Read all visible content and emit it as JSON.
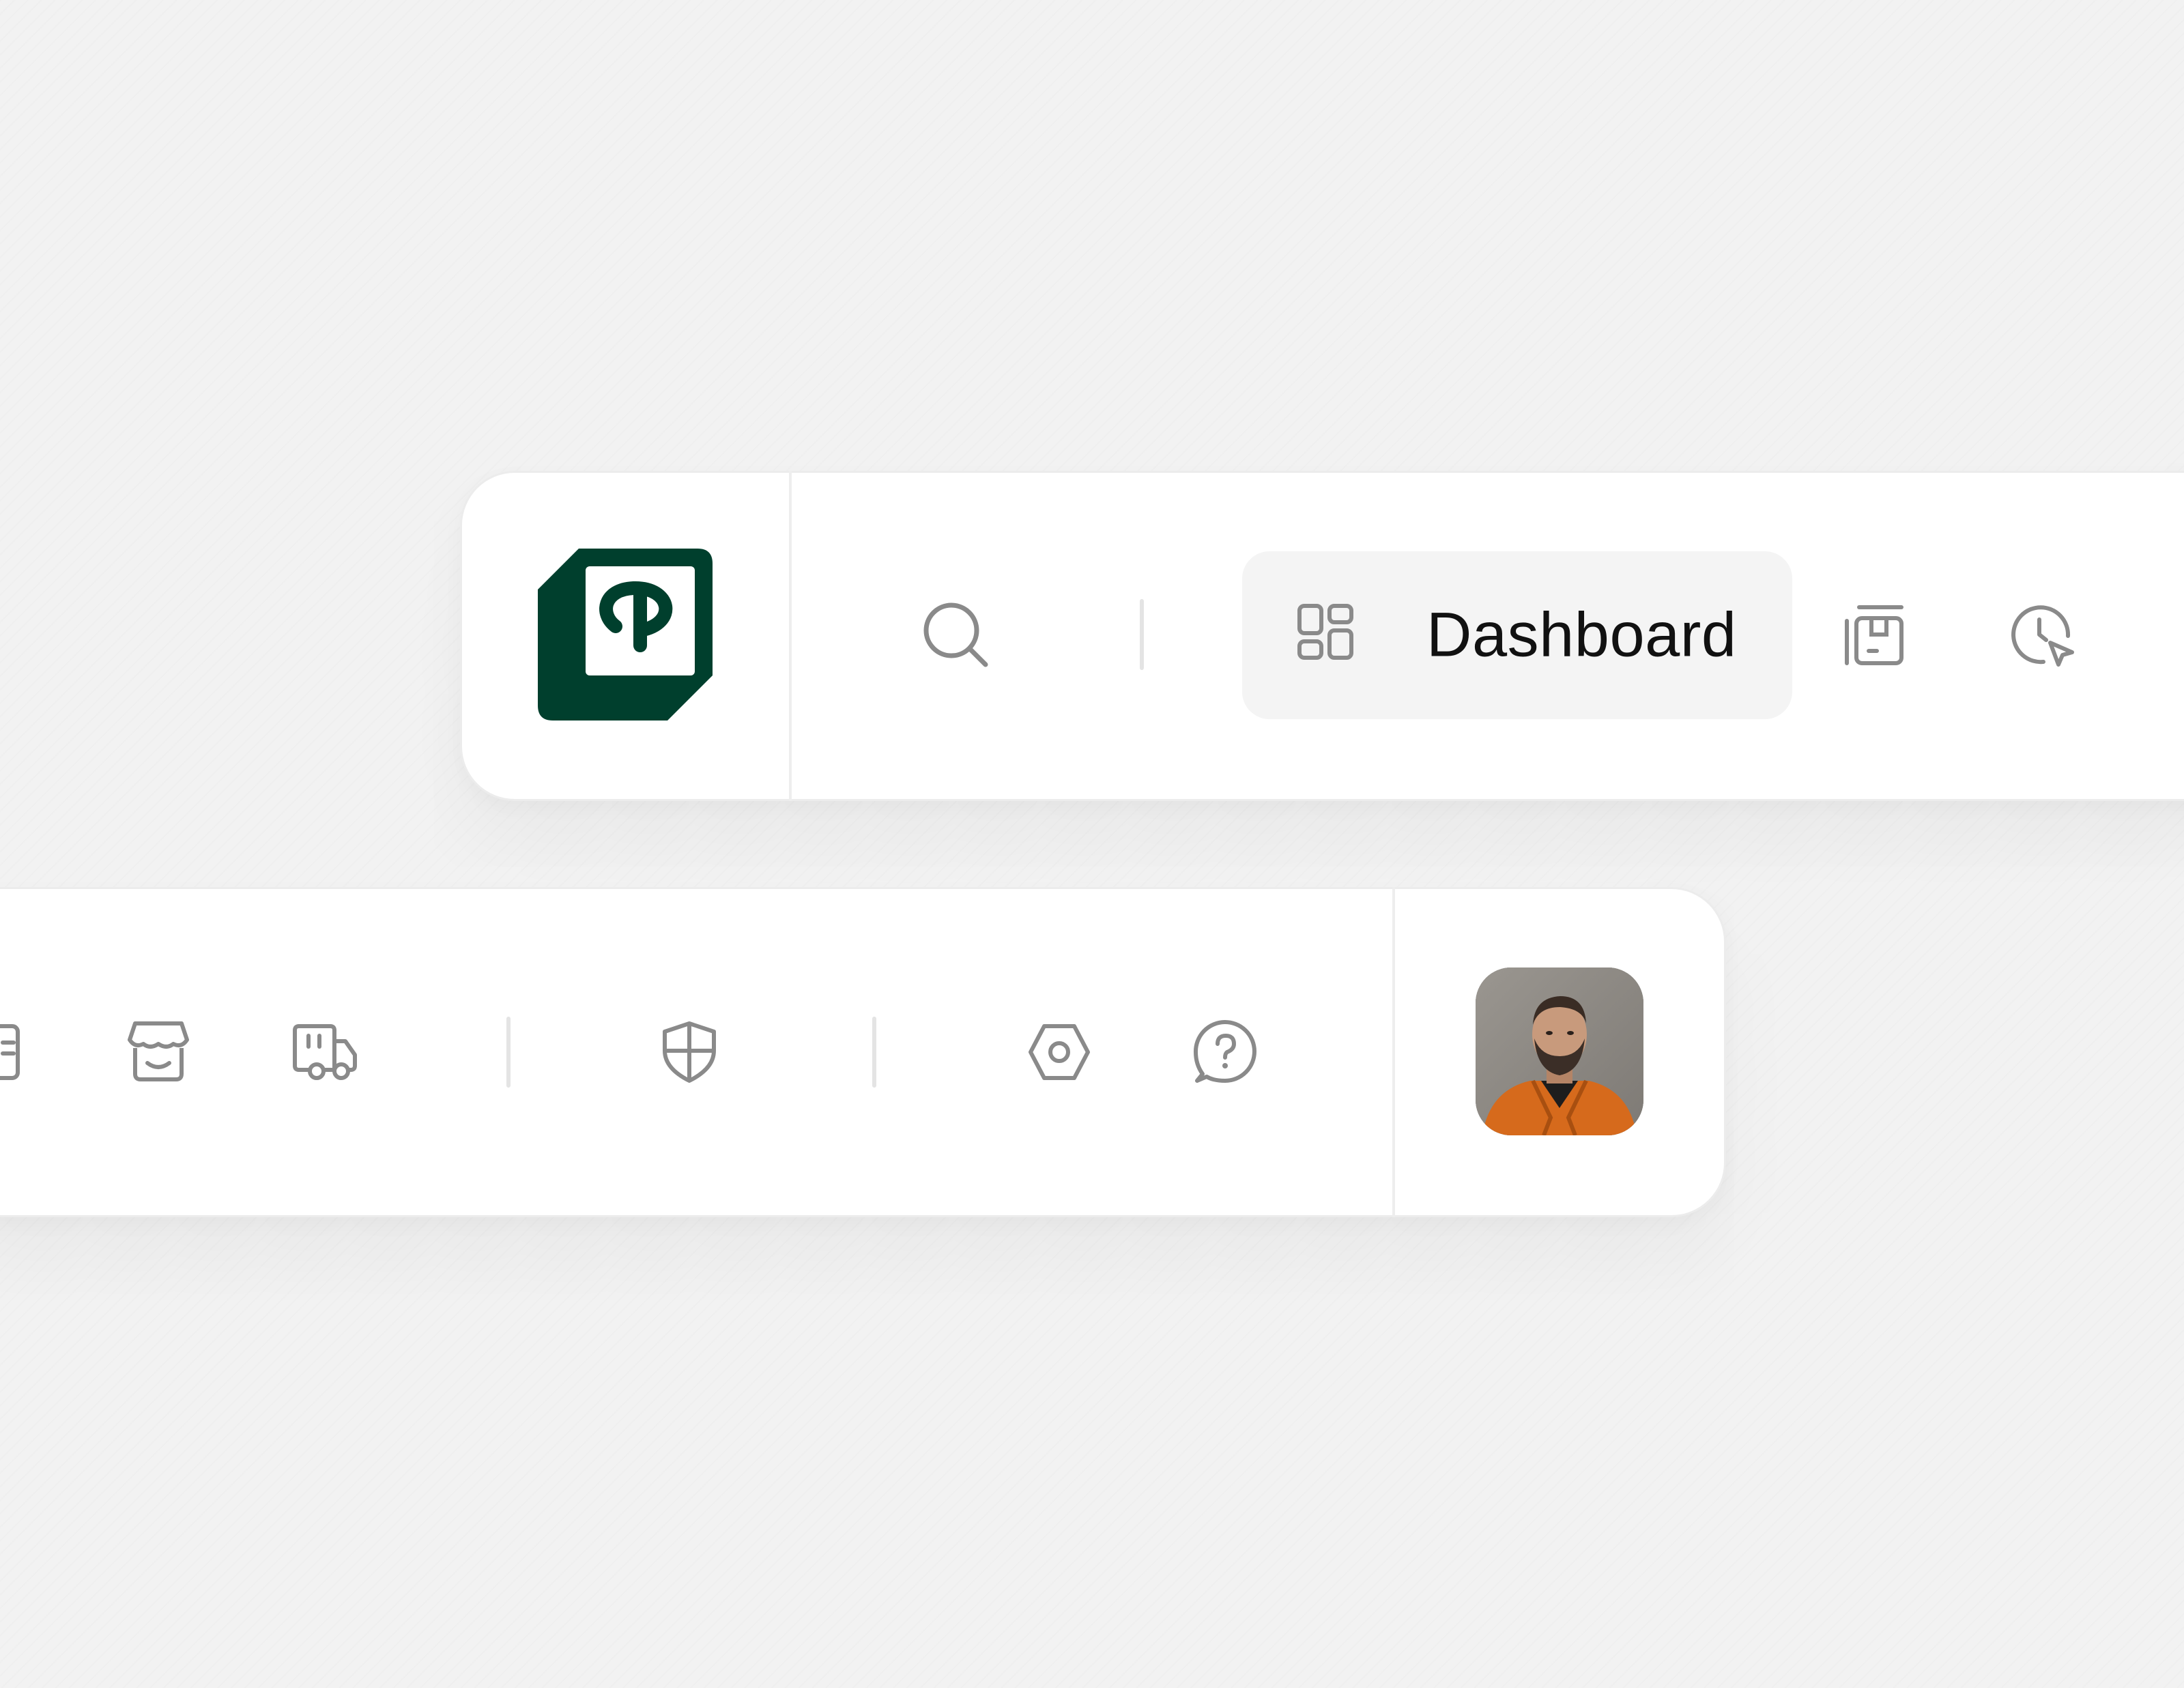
{
  "brand": {
    "logo_name": "P",
    "logo_color": "#003f2d"
  },
  "top_bar": {
    "search_icon": "search-icon",
    "active_item": {
      "icon": "dashboard-grid-icon",
      "label": "Dashboard"
    },
    "items": [
      {
        "icon": "inventory-box-icon"
      },
      {
        "icon": "clock-cursor-icon"
      }
    ]
  },
  "bottom_bar": {
    "items": [
      {
        "icon": "document-icon"
      },
      {
        "icon": "store-icon"
      },
      {
        "icon": "delivery-truck-icon"
      },
      {
        "icon": "shield-icon"
      },
      {
        "icon": "settings-hexagon-icon"
      },
      {
        "icon": "help-chat-icon"
      }
    ],
    "avatar": "user-avatar"
  },
  "colors": {
    "background": "#f2f2f2",
    "surface": "#ffffff",
    "icon": "#8a8a8a",
    "active_bg": "#f4f4f4",
    "text": "#111111",
    "brand": "#003f2d"
  }
}
